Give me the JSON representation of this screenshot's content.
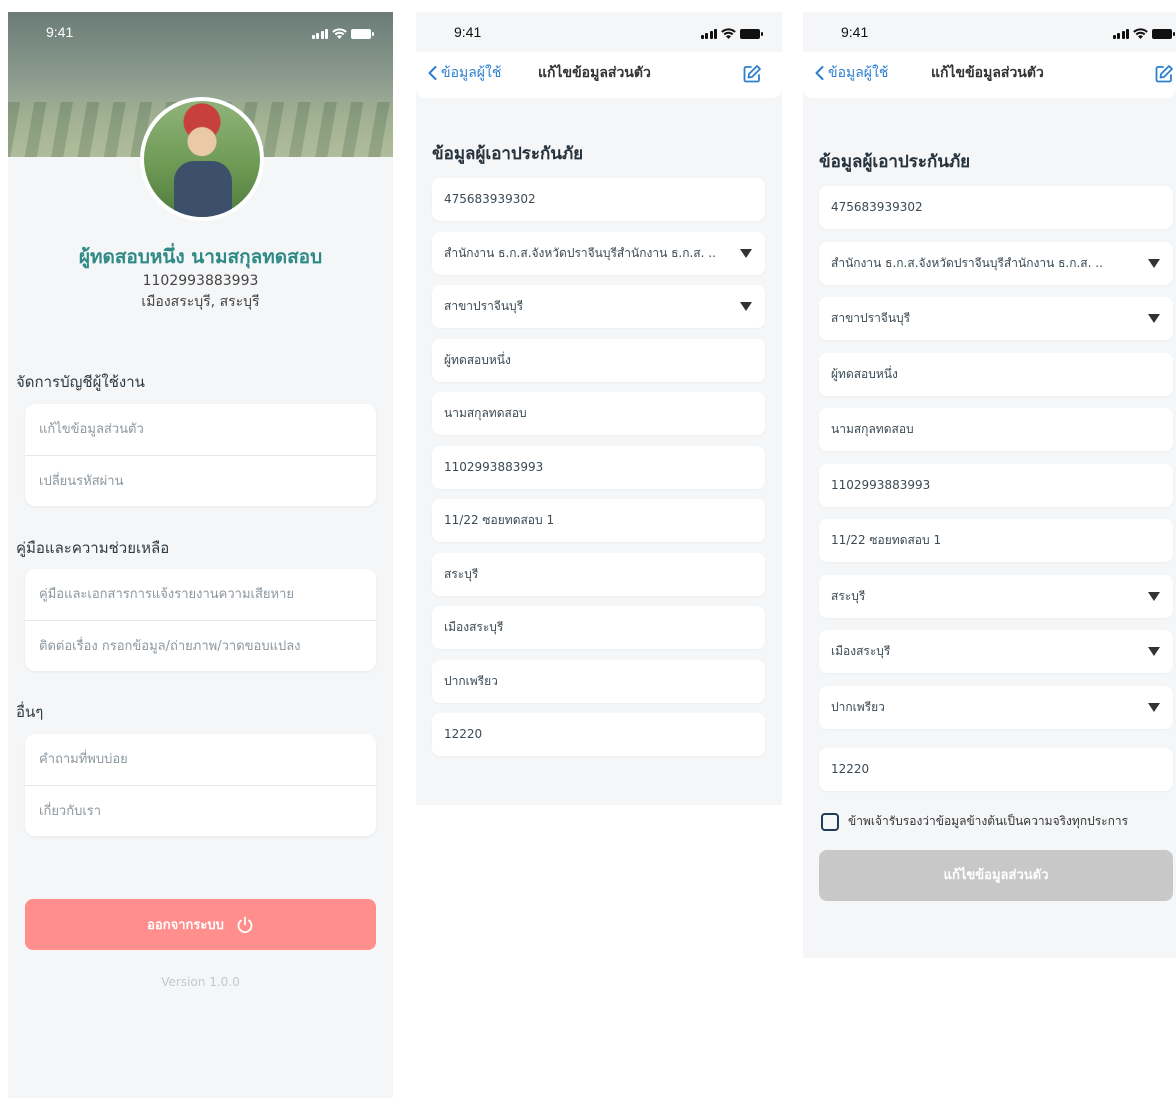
{
  "status": {
    "time": "9:41"
  },
  "profile": {
    "name": "ผู้ทดสอบหนึ่ง นามสกุลทดสอบ",
    "id_number": "1102993883993",
    "location": "เมืองสระบุรี, สระบุรี"
  },
  "account_section": {
    "title": "จัดการบัญชีผู้ใช้งาน",
    "items": [
      "แก้ไขข้อมูลส่วนตัว",
      "เปลี่ยนรหัสผ่าน"
    ]
  },
  "help_section": {
    "title": "คู่มือและความช่วยเหลือ",
    "items": [
      "คู่มือและเอกสารการแจ้งรายงานความเสียหาย",
      "ติดต่อเรื่อง กรอกข้อมูล/ถ่ายภาพ/วาดขอบแปลง"
    ]
  },
  "other_section": {
    "title": "อื่นๆ",
    "items": [
      "คำถามที่พบบ่อย",
      "เกี่ยวกับเรา"
    ]
  },
  "logout_label": "ออกจากระบบ",
  "version": "Version 1.0.0",
  "edit_nav": {
    "back_label": "ข้อมูลผู้ใช้",
    "title": "แก้ไขข้อมูลส่วนตัว"
  },
  "form": {
    "title": "ข้อมูลผู้เอาประกันภัย",
    "fields": [
      "475683939302",
      "สำนักงาน ธ.ก.ส.จังหวัดปราจีนบุรีสำนักงาน ธ.ก.ส. ..",
      "สาขาปราจีนบุรี",
      "ผู้ทดสอบหนึ่ง",
      "นามสกุลทดสอบ",
      "1102993883993",
      "11/22 ซอยทดสอบ 1",
      "สระบุรี",
      "เมืองสระบุรี",
      "ปากเพรียว",
      "12220"
    ],
    "agree_label": "ข้าพเจ้ารับรองว่าข้อมูลข้างต้นเป็นความจริงทุกประการ",
    "submit_label": "แก้ไขข้อมูลส่วนตัว"
  },
  "colors": {
    "accent_teal": "#2e8a85",
    "logout_red": "#ff8e8c",
    "link_blue": "#2d7fd0",
    "disabled_gray": "#c8c8c8"
  }
}
